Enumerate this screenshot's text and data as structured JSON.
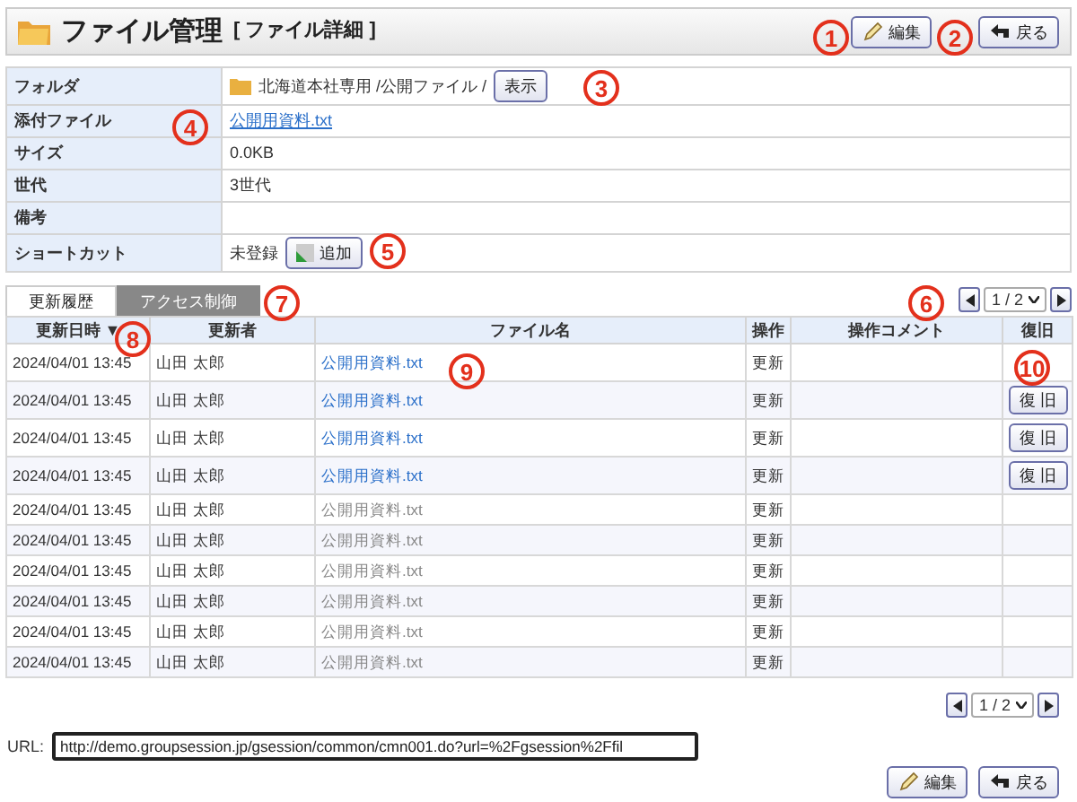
{
  "header": {
    "title": "ファイル管理",
    "subtitle": "[ ファイル詳細 ]",
    "buttons": [
      {
        "kind": "edit",
        "label": "編集"
      },
      {
        "kind": "back",
        "label": "戻る"
      }
    ]
  },
  "details": [
    {
      "label": "フォルダ",
      "kind": "folder",
      "value": "北海道本社専用 /公開ファイル /",
      "button": "表示"
    },
    {
      "label": "添付ファイル",
      "kind": "link",
      "value": "公開用資料.txt"
    },
    {
      "label": "サイズ",
      "kind": "text",
      "value": "0.0KB"
    },
    {
      "label": "世代",
      "kind": "text",
      "value": "3世代"
    },
    {
      "label": "備考",
      "kind": "text"
    },
    {
      "label": "ショートカット",
      "kind": "shortcut",
      "value": "未登録",
      "button": "追加"
    }
  ],
  "tabs": [
    {
      "label": "更新履歴",
      "selected": true
    },
    {
      "label": "アクセス制御",
      "selected": false
    }
  ],
  "top_pager": {
    "page": "1 / 2"
  },
  "table": {
    "columns": [
      {
        "label": "更新日時",
        "sort_mark": "▼"
      },
      {
        "label": "更新者"
      },
      {
        "label": "ファイル名"
      },
      {
        "label": "操作"
      },
      {
        "label": "操作コメント"
      },
      {
        "label": "復旧"
      }
    ],
    "rows": [
      {
        "date": "2024/04/01 13:45",
        "user": "山田 太郎",
        "file": "公開用資料.txt",
        "linked": true,
        "op": "更新"
      },
      {
        "date": "2024/04/01 13:45",
        "user": "山田 太郎",
        "file": "公開用資料.txt",
        "linked": true,
        "op": "更新",
        "restore": "復 旧"
      },
      {
        "date": "2024/04/01 13:45",
        "user": "山田 太郎",
        "file": "公開用資料.txt",
        "linked": true,
        "op": "更新",
        "restore": "復 旧"
      },
      {
        "date": "2024/04/01 13:45",
        "user": "山田 太郎",
        "file": "公開用資料.txt",
        "linked": true,
        "op": "更新",
        "restore": "復 旧"
      },
      {
        "date": "2024/04/01 13:45",
        "user": "山田 太郎",
        "file": "公開用資料.txt",
        "linked": false,
        "op": "更新"
      },
      {
        "date": "2024/04/01 13:45",
        "user": "山田 太郎",
        "file": "公開用資料.txt",
        "linked": false,
        "op": "更新"
      },
      {
        "date": "2024/04/01 13:45",
        "user": "山田 太郎",
        "file": "公開用資料.txt",
        "linked": false,
        "op": "更新"
      },
      {
        "date": "2024/04/01 13:45",
        "user": "山田 太郎",
        "file": "公開用資料.txt",
        "linked": false,
        "op": "更新"
      },
      {
        "date": "2024/04/01 13:45",
        "user": "山田 太郎",
        "file": "公開用資料.txt",
        "linked": false,
        "op": "更新"
      },
      {
        "date": "2024/04/01 13:45",
        "user": "山田 太郎",
        "file": "公開用資料.txt",
        "linked": false,
        "op": "更新"
      }
    ]
  },
  "bottom_pager": {
    "page": "1 / 2"
  },
  "url": {
    "label": "URL:",
    "value": "http://demo.groupsession.jp/gsession/common/cmn001.do?url=%2Fgsession%2Ffil"
  },
  "footer_buttons": [
    {
      "kind": "edit",
      "label": "編集"
    },
    {
      "kind": "back",
      "label": "戻る"
    }
  ],
  "callouts": [
    "1",
    "2",
    "3",
    "4",
    "5",
    "6",
    "7",
    "8",
    "9",
    "10"
  ]
}
